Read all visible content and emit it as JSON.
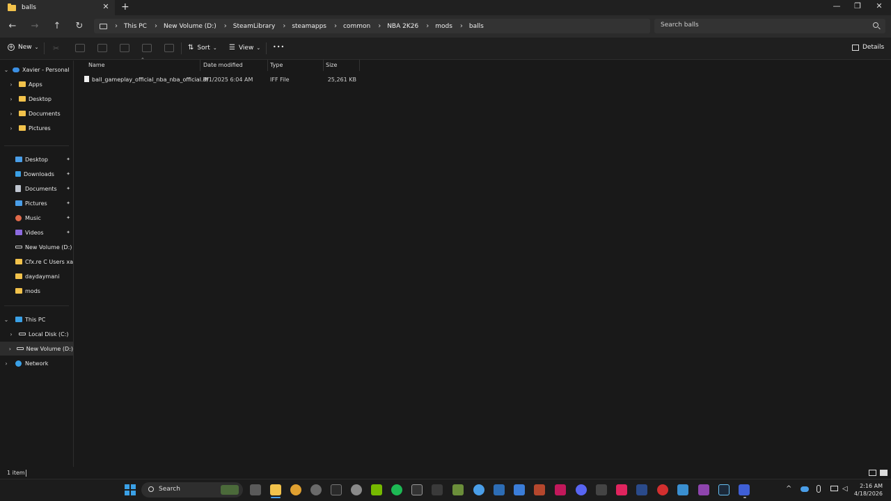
{
  "window": {
    "tab_title": "balls",
    "tab_close": "✕",
    "new_tab": "+",
    "minimize": "—",
    "maximize": "❐",
    "close": "✕"
  },
  "nav": {
    "back": "←",
    "forward": "→",
    "up": "↑",
    "refresh": "↻",
    "breadcrumb": [
      "This PC",
      "New Volume (D:)",
      "SteamLibrary",
      "steamapps",
      "common",
      "NBA 2K26",
      "mods",
      "balls"
    ],
    "search_placeholder": "Search balls"
  },
  "commands": {
    "new": "New",
    "sort": "Sort",
    "view": "View",
    "more": "•••",
    "details": "Details"
  },
  "sidebar": {
    "onedrive": "Xavier - Personal",
    "onedrive_children": [
      "Apps",
      "Desktop",
      "Documents",
      "Pictures"
    ],
    "quick_access": [
      {
        "label": "Desktop",
        "icon": "desktop-icon",
        "pinned": true
      },
      {
        "label": "Downloads",
        "icon": "downloads-icon",
        "pinned": true
      },
      {
        "label": "Documents",
        "icon": "documents-icon",
        "pinned": true
      },
      {
        "label": "Pictures",
        "icon": "pictures-icon",
        "pinned": true
      },
      {
        "label": "Music",
        "icon": "music-icon",
        "pinned": true
      },
      {
        "label": "Videos",
        "icon": "videos-icon",
        "pinned": true
      },
      {
        "label": "New Volume (D:)",
        "icon": "drive-icon",
        "pinned": false
      },
      {
        "label": "Cfx.re  C  Users xavi",
        "icon": "folder-icon",
        "pinned": false
      },
      {
        "label": "daydaymani",
        "icon": "folder-icon",
        "pinned": false
      },
      {
        "label": "mods",
        "icon": "folder-icon",
        "pinned": false
      }
    ],
    "this_pc": "This PC",
    "local_disk": "Local Disk (C:)",
    "new_volume": "New Volume (D:)",
    "network": "Network",
    "pin_glyph": "📌"
  },
  "columns": {
    "name": "Name",
    "date": "Date modified",
    "type": "Type",
    "size": "Size"
  },
  "files": [
    {
      "name": "ball_gameplay_official_nba_nba_official.iff",
      "date": "9/1/2025 6:04 AM",
      "type": "IFF File",
      "size": "25,261 KB"
    }
  ],
  "status": {
    "count": "1 item"
  },
  "taskbar": {
    "search_label": "Search",
    "time": "2:16 AM",
    "date": "4/18/2026",
    "tray_chevron": "^"
  },
  "colors": {
    "accent": "#4a9ee8",
    "folder": "#f2c24b"
  }
}
